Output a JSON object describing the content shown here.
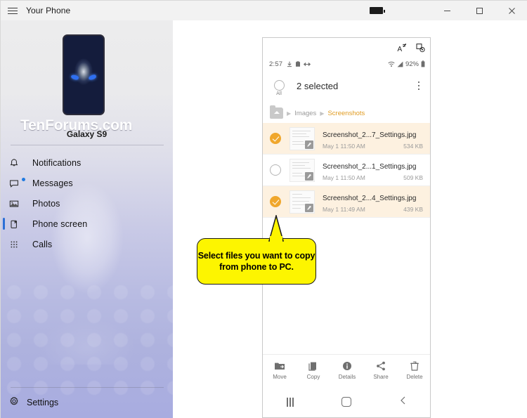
{
  "window": {
    "title": "Your Phone",
    "battery_icon": "battery-full-icon",
    "controls": {
      "minimize": "minimize-button",
      "maximize": "maximize-button",
      "close": "close-button"
    }
  },
  "sidebar": {
    "device_name": "Galaxy S9",
    "device_thumb_icon": "phone-wallpaper-thumbnail",
    "items": [
      {
        "label": "Notifications",
        "icon": "bell-icon",
        "selected": false
      },
      {
        "label": "Messages",
        "icon": "message-icon",
        "selected": false,
        "badge": true
      },
      {
        "label": "Photos",
        "icon": "photo-icon",
        "selected": false
      },
      {
        "label": "Phone screen",
        "icon": "phone-screen-icon",
        "selected": true
      },
      {
        "label": "Calls",
        "icon": "dialpad-icon",
        "selected": false
      }
    ],
    "settings": {
      "label": "Settings",
      "icon": "gear-icon"
    }
  },
  "watermark": "TenForums.com",
  "phone": {
    "top_icons": [
      {
        "name": "font-size-icon"
      },
      {
        "name": "screenshot-icon"
      }
    ],
    "status_bar": {
      "time": "2:57",
      "left_icons": [
        "download-icon",
        "clipboard-icon",
        "arrows-icon"
      ],
      "wifi_icon": "wifi-icon",
      "signal_icon": "signal-icon",
      "battery_percent": "92%",
      "battery_icon": "battery-icon"
    },
    "selection_bar": {
      "select_all_label": "All",
      "selected_count": "2 selected",
      "overflow_icon": "overflow-menu-icon"
    },
    "breadcrumb": {
      "home_icon": "home-folder-icon",
      "crumbs": [
        {
          "label": "Images",
          "active": false
        },
        {
          "label": "Screenshots",
          "active": true
        }
      ]
    },
    "files": [
      {
        "name": "Screenshot_2...7_Settings.jpg",
        "date": "May 1 11:50 AM",
        "size": "534 KB",
        "selected": true
      },
      {
        "name": "Screenshot_2...1_Settings.jpg",
        "date": "May 1 11:50 AM",
        "size": "509 KB",
        "selected": false
      },
      {
        "name": "Screenshot_2...4_Settings.jpg",
        "date": "May 1 11:49 AM",
        "size": "439 KB",
        "selected": true
      }
    ],
    "actions": [
      {
        "label": "Move",
        "icon": "move-folder-icon"
      },
      {
        "label": "Copy",
        "icon": "copy-icon"
      },
      {
        "label": "Details",
        "icon": "info-icon"
      },
      {
        "label": "Share",
        "icon": "share-icon"
      },
      {
        "label": "Delete",
        "icon": "trash-icon"
      }
    ],
    "nav_bar": {
      "recents": "recents-icon",
      "home": "home-icon",
      "back": "back-icon"
    }
  },
  "callout": {
    "text": "Select files you want to copy from phone to PC."
  },
  "colors": {
    "accent_selected": "#f0a72c",
    "row_highlight": "#fdf1e0",
    "breadcrumb_active": "#e09b21",
    "nav_selected_bar": "#2b6fd6",
    "callout_bg": "#fdf500"
  }
}
